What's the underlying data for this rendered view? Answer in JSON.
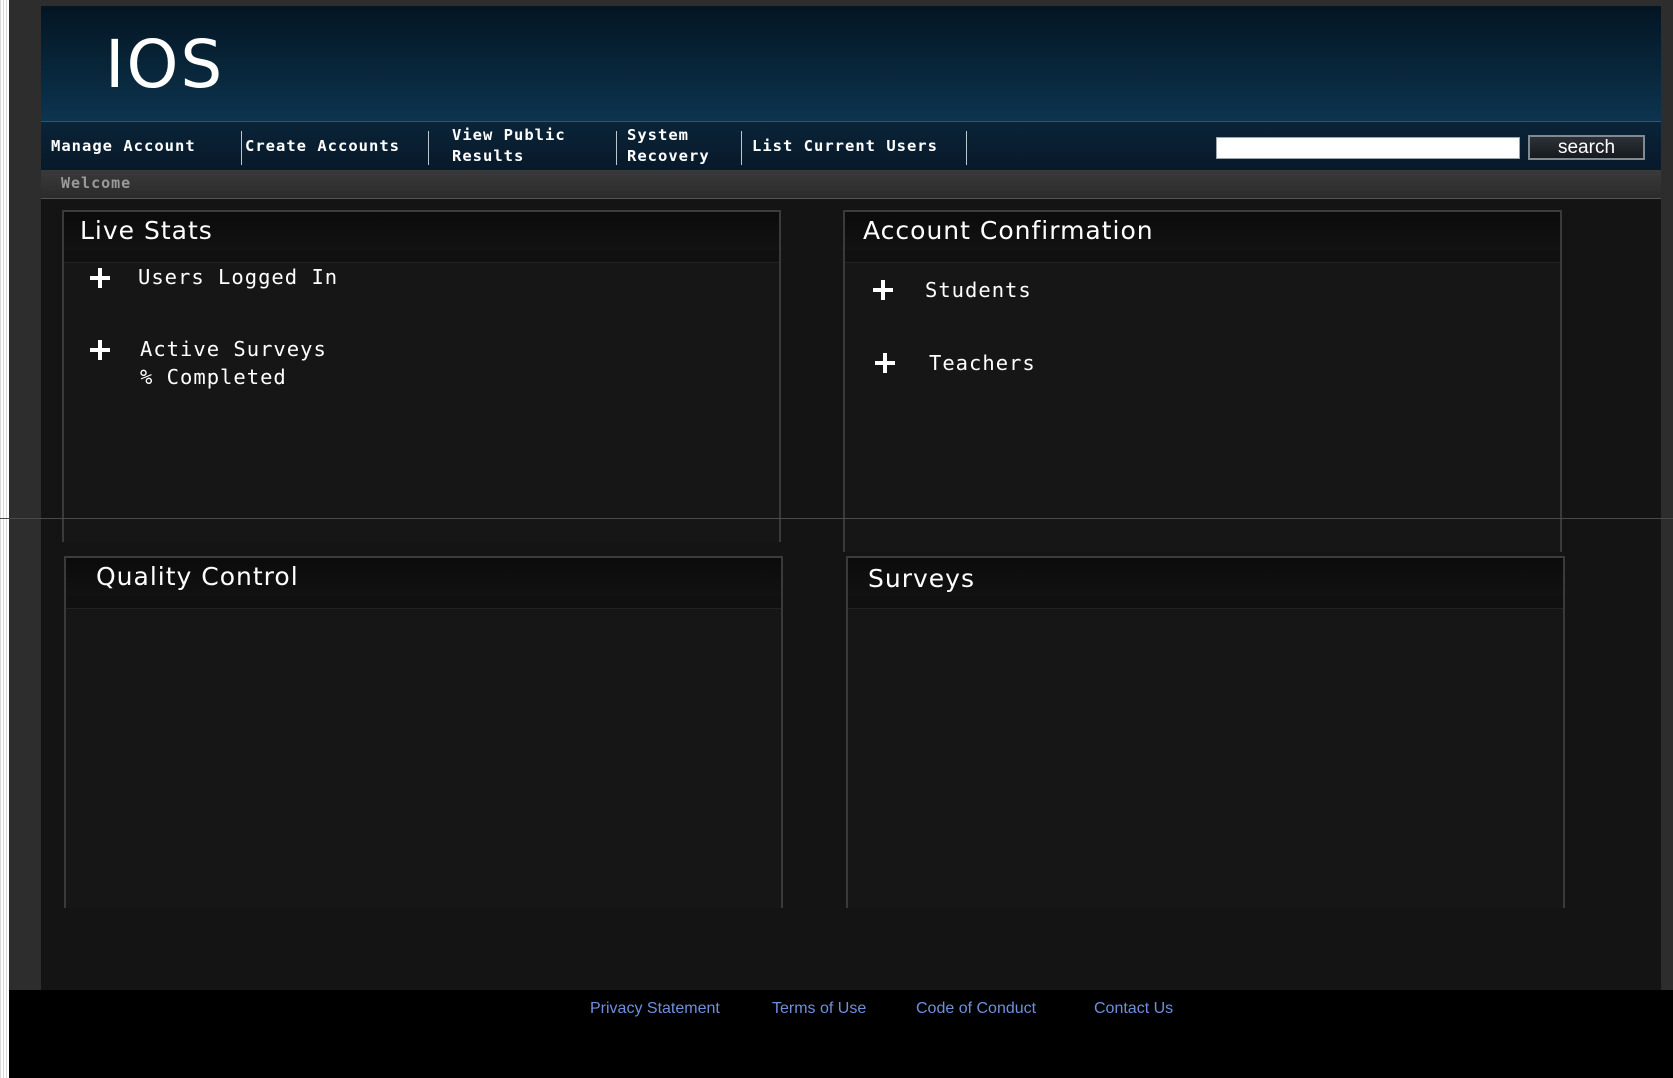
{
  "app": {
    "logo_text": "IOS"
  },
  "nav": {
    "items": [
      {
        "label": "Manage Account"
      },
      {
        "label": "Create Accounts"
      },
      {
        "label": "View Public Results"
      },
      {
        "label": "System Recovery"
      },
      {
        "label": "List Current Users"
      }
    ],
    "search_value": "",
    "search_button_label": "search"
  },
  "breadcrumb": {
    "label": "Welcome"
  },
  "panels": {
    "live_stats": {
      "title": "Live Stats",
      "items": [
        {
          "label": "Users Logged In"
        },
        {
          "label": "Active Surveys",
          "sublabel": "% Completed"
        }
      ]
    },
    "account_confirmation": {
      "title": "Account Confirmation",
      "items": [
        {
          "label": "Students"
        },
        {
          "label": "Teachers"
        }
      ]
    },
    "quality_control": {
      "title": "Quality Control"
    },
    "surveys": {
      "title": "Surveys"
    }
  },
  "footer": {
    "links": [
      {
        "label": "Privacy Statement"
      },
      {
        "label": "Terms of Use"
      },
      {
        "label": "Code of Conduct"
      },
      {
        "label": "Contact Us"
      }
    ]
  },
  "colors": {
    "header_navy": "#08263a",
    "panel_bg": "#161616",
    "footer_link": "#6f8fdc"
  },
  "icons": {
    "expand": "plus-icon"
  }
}
